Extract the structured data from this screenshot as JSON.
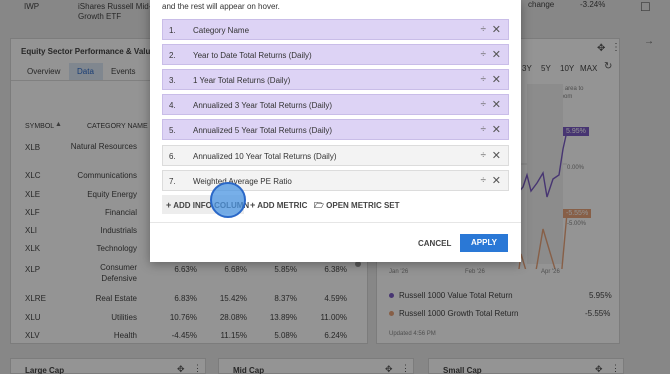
{
  "top_row": {
    "symbol": "IWP",
    "name_line1": "iShares Russell Mid-C",
    "name_line2": "Growth ETF",
    "right_fragment": "change",
    "right_value": "-3.24%"
  },
  "sector_panel": {
    "title": "Equity Sector Performance & Valuatio",
    "tabs": [
      "Overview",
      "Data",
      "Events"
    ],
    "col_symbol": "SYMBOL",
    "col_category": "CATEGORY NAME",
    "rows": [
      {
        "symbol": "XLB",
        "category": "Natural Resources",
        "c1": "",
        "c2": "",
        "c3": "",
        "c4": ""
      },
      {
        "symbol": "XLC",
        "category": "Communications",
        "c1": "",
        "c2": "",
        "c3": "",
        "c4": ""
      },
      {
        "symbol": "XLE",
        "category": "Equity Energy",
        "c1": "",
        "c2": "",
        "c3": "",
        "c4": ""
      },
      {
        "symbol": "XLF",
        "category": "Financial",
        "c1": "",
        "c2": "",
        "c3": "",
        "c4": ""
      },
      {
        "symbol": "XLI",
        "category": "Industrials",
        "c1": "",
        "c2": "",
        "c3": "",
        "c4": ""
      },
      {
        "symbol": "XLK",
        "category": "Technology",
        "c1": "",
        "c2": "",
        "c3": "",
        "c4": ""
      },
      {
        "symbol": "XLP",
        "category": "Consumer Defensive",
        "c1": "6.63%",
        "c2": "6.68%",
        "c3": "5.85%",
        "c4": "6.38%"
      },
      {
        "symbol": "XLRE",
        "category": "Real Estate",
        "c1": "6.83%",
        "c2": "15.42%",
        "c3": "8.37%",
        "c4": "4.59%"
      },
      {
        "symbol": "XLU",
        "category": "Utilities",
        "c1": "10.76%",
        "c2": "28.08%",
        "c3": "13.89%",
        "c4": "11.00%"
      },
      {
        "symbol": "XLV",
        "category": "Health",
        "c1": "-4.45%",
        "c2": "11.15%",
        "c3": "5.08%",
        "c4": "6.24%"
      }
    ]
  },
  "chart_panel": {
    "ranges": [
      "3Y",
      "5Y",
      "10Y",
      "MAX"
    ],
    "select_hint": "Select area to zoom",
    "legend": [
      {
        "name": "Russell 1000 Value Total Return",
        "value": "5.95%",
        "color": "#7b5cc4"
      },
      {
        "name": "Russell 1000 Growth Total Return",
        "value": "-5.55%",
        "color": "#e8a47a"
      }
    ],
    "updated": "Updated 4:56 PM",
    "x_labels": [
      "Jan '26",
      "Feb '26",
      "Apr '26"
    ],
    "y_labels": [
      "0.00%",
      "-5.00%"
    ],
    "badge_value": "5.95%",
    "badge_value2": "-5.55%"
  },
  "bottom_panels": [
    "Large Cap",
    "Mid Cap",
    "Small Cap"
  ],
  "modal": {
    "header": "and the rest will appear on hover.",
    "metrics": [
      {
        "num": "1.",
        "label": "Category Name"
      },
      {
        "num": "2.",
        "label": "Year to Date Total Returns (Daily)"
      },
      {
        "num": "3.",
        "label": "1 Year Total Returns (Daily)"
      },
      {
        "num": "4.",
        "label": "Annualized 3 Year Total Returns (Daily)"
      },
      {
        "num": "5.",
        "label": "Annualized 5 Year Total Returns (Daily)"
      },
      {
        "num": "6.",
        "label": "Annualized 10 Year Total Returns (Daily)"
      },
      {
        "num": "7.",
        "label": "Weighted Average PE Ratio"
      }
    ],
    "add_info_column": "ADD INFO COLUMN",
    "add_metric": "ADD METRIC",
    "open_metric_set": "OPEN METRIC SET",
    "cancel": "CANCEL",
    "apply": "APPLY"
  }
}
